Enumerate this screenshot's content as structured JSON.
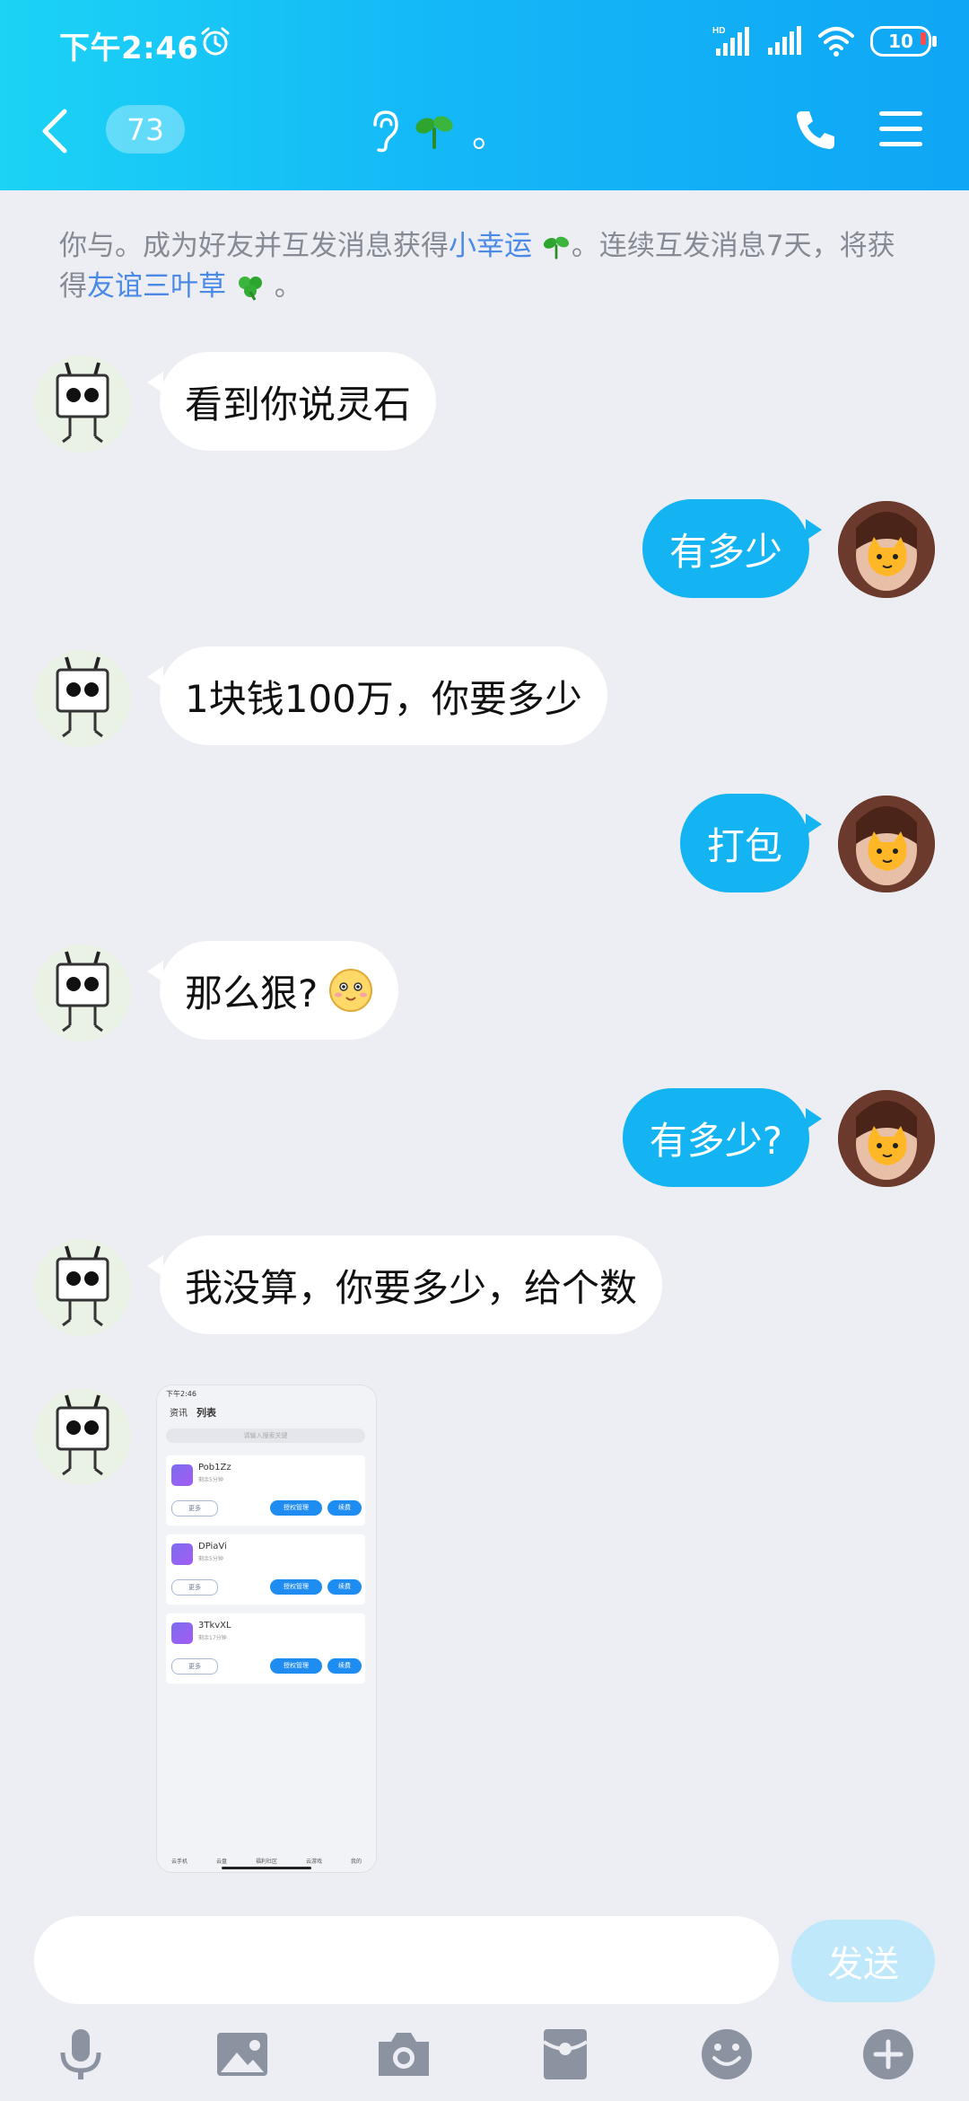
{
  "status_bar": {
    "time": "下午2:46",
    "battery": "10",
    "network": "HD"
  },
  "header": {
    "unread_count": "73",
    "title": "。"
  },
  "system_message": {
    "part1": "你与。成为好友并互发消息获得",
    "link1": "小幸运",
    "part2": "。连续互发消息7天，将获得",
    "link2": "友谊三叶草",
    "part3": "。"
  },
  "messages": [
    {
      "side": "left",
      "text": "看到你说灵石"
    },
    {
      "side": "right",
      "text": "有多少"
    },
    {
      "side": "left",
      "text": "1块钱100万，你要多少"
    },
    {
      "side": "right",
      "text": "打包"
    },
    {
      "side": "left",
      "text": "那么狠?"
    },
    {
      "side": "right",
      "text": "有多少?"
    },
    {
      "side": "left",
      "text": "我没算，你要多少，给个数"
    }
  ],
  "image_message": {
    "status_time": "下午2:46",
    "tabs": [
      "资讯",
      "列表"
    ],
    "search_placeholder": "请输入搜索关键",
    "cards": [
      {
        "name": "Pob1Zz",
        "sub": "剩余5分钟",
        "more": "更多",
        "btn1": "授权管理",
        "btn2": "续费"
      },
      {
        "name": "DPiaVi",
        "sub": "剩余5分钟",
        "more": "更多",
        "btn1": "授权管理",
        "btn2": "续费"
      },
      {
        "name": "3TkvXL",
        "sub": "剩余17分钟",
        "more": "更多",
        "btn1": "授权管理",
        "btn2": "续费"
      }
    ],
    "nav": [
      "云手机",
      "云盘",
      "福利社区",
      "云游戏",
      "我的"
    ]
  },
  "input": {
    "placeholder": "",
    "send_label": "发送"
  },
  "toolbar_icons": [
    "microphone-icon",
    "image-icon",
    "camera-icon",
    "red-packet-icon",
    "emoji-icon",
    "plus-icon"
  ]
}
